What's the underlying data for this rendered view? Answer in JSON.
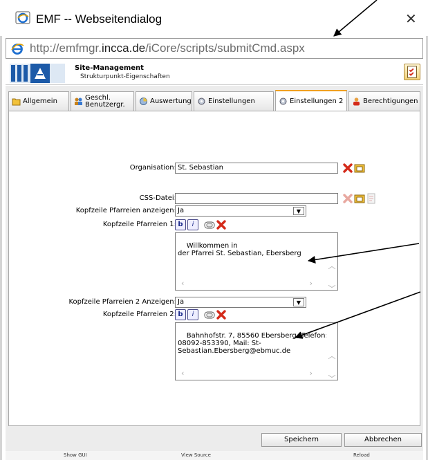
{
  "window": {
    "title": "EMF -- Webseitendialog",
    "close_glyph": "✕"
  },
  "address": {
    "prefix": "http://emfmgr.",
    "domain": "incca.de",
    "path": "/iCore/scripts/submitCmd.aspx"
  },
  "banner": {
    "title": "Site-Management",
    "subtitle": "Strukturpunkt-Eigenschaften"
  },
  "tabs": [
    {
      "label": "Allgemein"
    },
    {
      "label": "Geschl.\nBenutzergr."
    },
    {
      "label": "Auswertung"
    },
    {
      "label": "Einstellungen"
    },
    {
      "label": "Einstellungen 2",
      "active": true
    },
    {
      "label": "Berechtigungen"
    }
  ],
  "form": {
    "organisation_label": "Organisation:",
    "organisation_value": "St. Sebastian",
    "css_label": "CSS-Datei:",
    "css_value": "",
    "kopf_show_label": "Kopfzeile Pfarreien anzeigen:",
    "kopf_show_value": "Ja",
    "kopf1_label": "Kopfzeile Pfarreien 1:",
    "kopf1_text": "Willkommen in\nder Pfarrei St. Sebastian, Ebersberg",
    "kopf2_show_label": "Kopfzeile Pfarreien 2 Anzeigen:",
    "kopf2_show_value": "Ja",
    "kopf2_label": "Kopfzeile Pfarreien 2:",
    "kopf2_text": "Bahnhofstr. 7, 85560 Ebersberg, Telefon:\n08092-853390, Mail: St-\nSebastian.Ebersberg@ebmuc.de",
    "bold_glyph": "b",
    "italic_glyph": "i"
  },
  "buttons": {
    "save": "Speichern",
    "cancel": "Abbrechen"
  },
  "status": {
    "show_gui": "Show GUI",
    "view_source": "View Source",
    "reload": "Reload"
  },
  "colors": {
    "active_tab_accent": "#f0a020",
    "delete_red": "#d42a1a",
    "ie_blue": "#1e6fd0"
  }
}
